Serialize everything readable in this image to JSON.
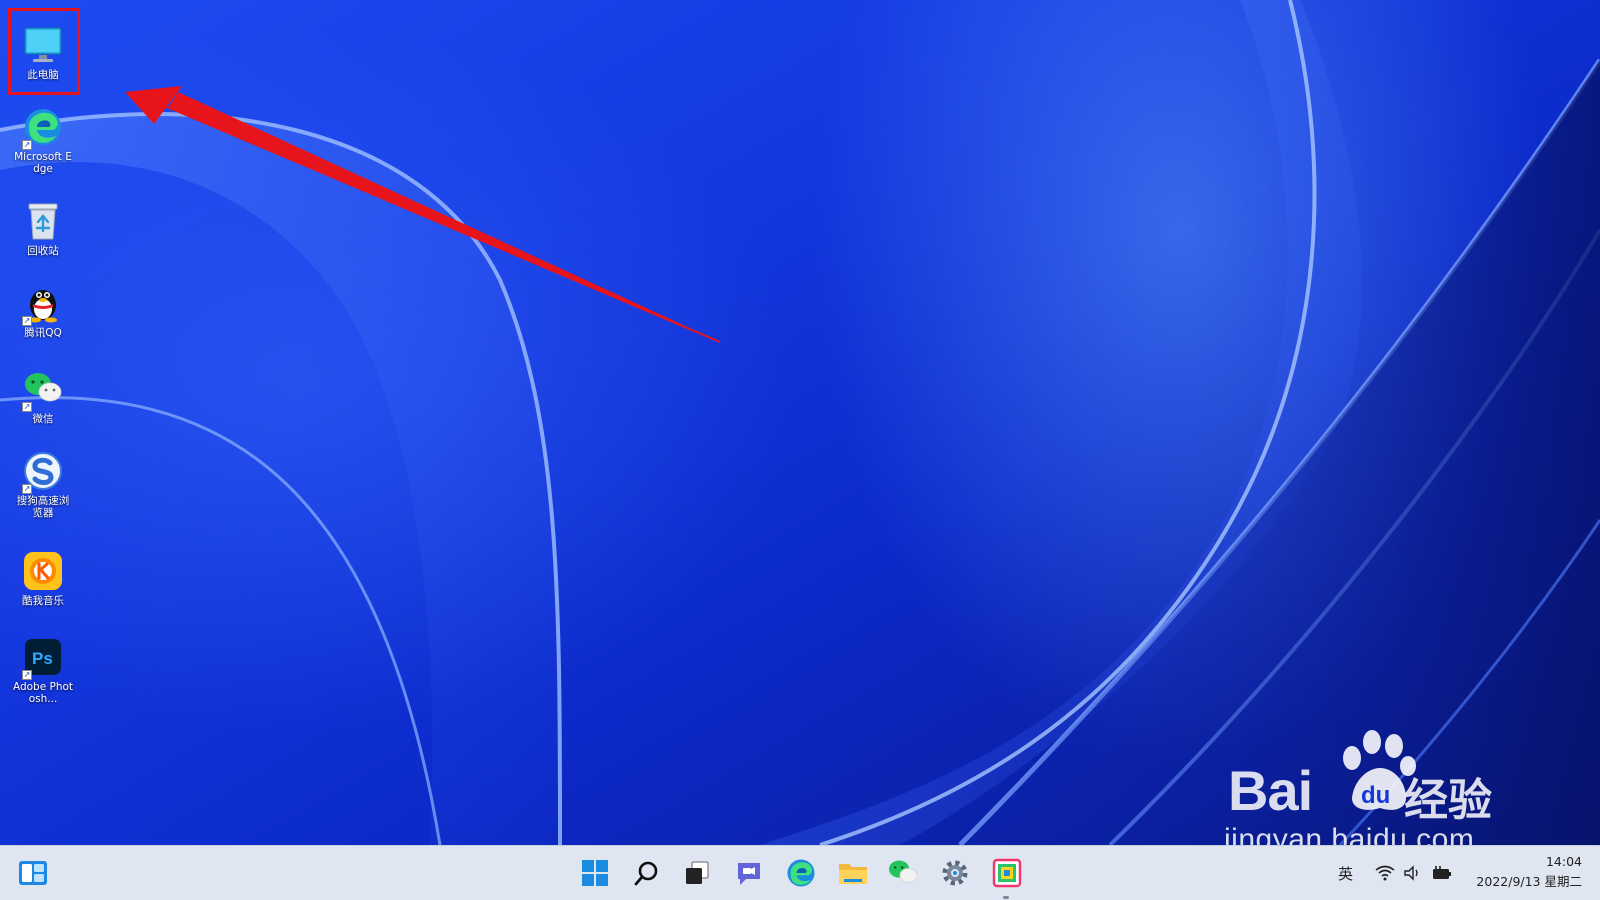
{
  "desktop": {
    "icons": [
      {
        "id": "this-pc",
        "label": "此电脑",
        "icon": "monitor-icon",
        "shortcut": false
      },
      {
        "id": "edge",
        "label": "Microsoft Edge",
        "icon": "edge-icon",
        "shortcut": true
      },
      {
        "id": "recycle-bin",
        "label": "回收站",
        "icon": "recycle-bin-icon",
        "shortcut": false
      },
      {
        "id": "qq",
        "label": "腾讯QQ",
        "icon": "qq-penguin-icon",
        "shortcut": true
      },
      {
        "id": "wechat",
        "label": "微信",
        "icon": "wechat-icon",
        "shortcut": true
      },
      {
        "id": "sogou",
        "label": "搜狗高速浏览器",
        "icon": "sogou-browser-icon",
        "shortcut": true
      },
      {
        "id": "kugou",
        "label": "酷我音乐",
        "icon": "music-app-icon",
        "shortcut": false
      },
      {
        "id": "photoshop",
        "label": "Adobe Photosh...",
        "icon": "photoshop-icon",
        "shortcut": true
      }
    ],
    "annotation_color": "#e8141c"
  },
  "watermark": {
    "brand": "Bai",
    "brand_du": "du",
    "product": "经验",
    "url": "jingyan.baidu.com"
  },
  "taskbar": {
    "apps": [
      "start-icon",
      "search-icon",
      "task-view-icon",
      "chat-icon",
      "edge-icon",
      "file-explorer-icon",
      "wechat-icon",
      "settings-gear-icon",
      "image-app-icon"
    ],
    "tray": {
      "input_method": "英",
      "time": "14:04",
      "date": "2022/9/13 星期二"
    }
  }
}
